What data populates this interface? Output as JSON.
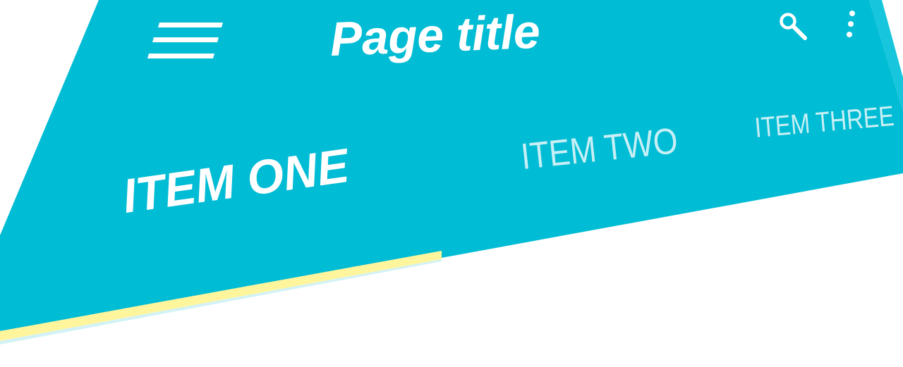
{
  "appbar": {
    "title": "Page title",
    "icons": {
      "menu": "hamburger-menu-icon",
      "search": "search-icon",
      "more": "more-vertical-icon"
    }
  },
  "tabs": [
    {
      "label": "ITEM ONE",
      "selected": true
    },
    {
      "label": "ITEM TWO",
      "selected": false
    },
    {
      "label": "ITEM THREE",
      "selected": false
    }
  ],
  "colors": {
    "primary": "#00BCD4",
    "indicator": "#FFF59D",
    "text": "#FFFFFF",
    "inactive_tab_text": "#D8F4F8",
    "background": "#FFFFFF"
  }
}
